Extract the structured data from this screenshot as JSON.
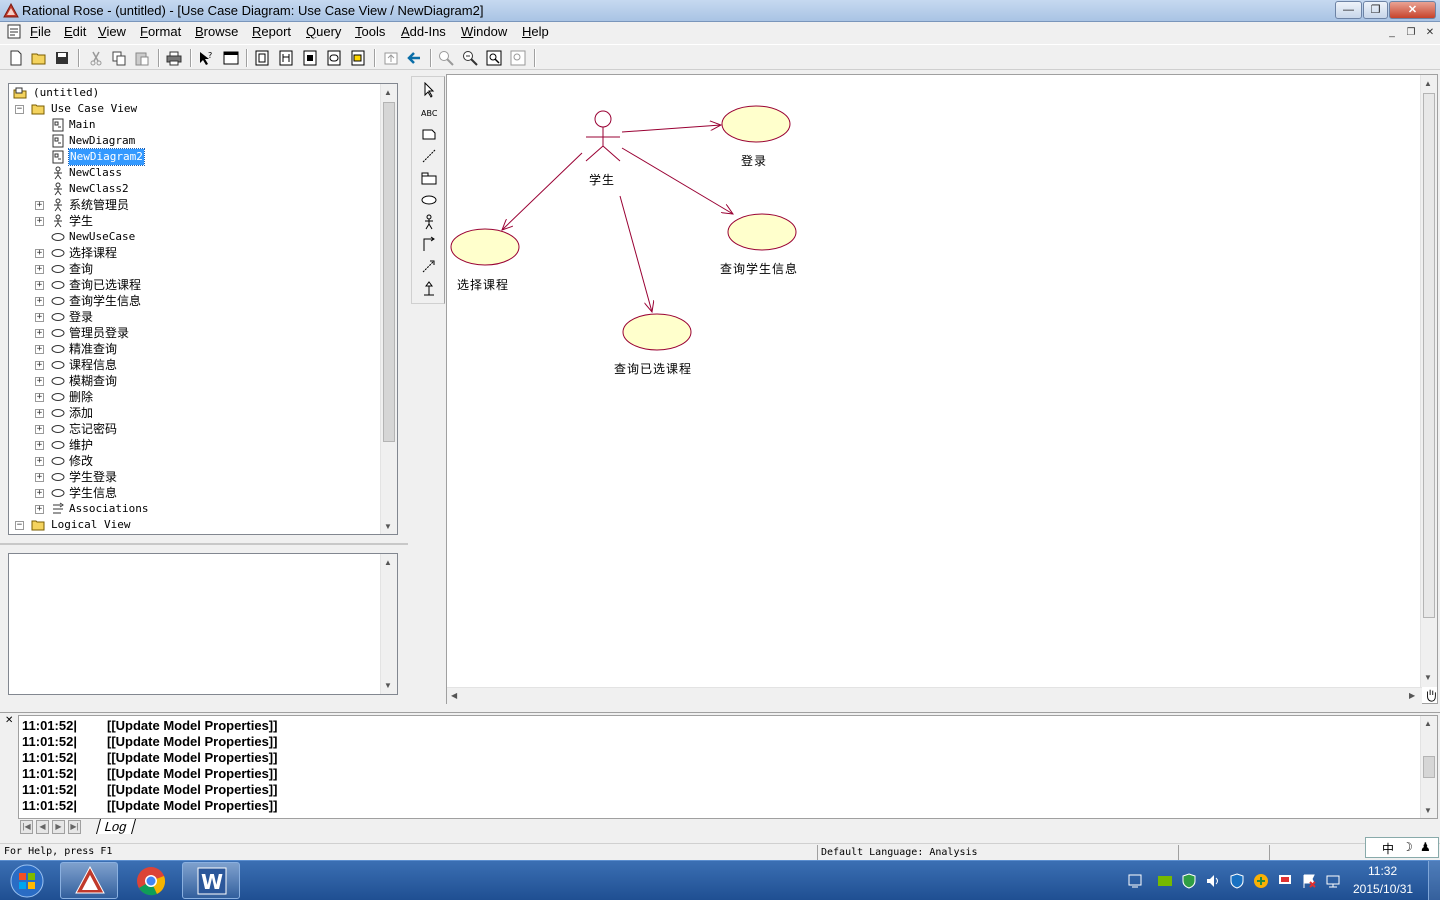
{
  "window": {
    "title": "Rational Rose - (untitled) - [Use Case Diagram: Use Case View / NewDiagram2]"
  },
  "menu": [
    "File",
    "Edit",
    "View",
    "Format",
    "Browse",
    "Report",
    "Query",
    "Tools",
    "Add-Ins",
    "Window",
    "Help"
  ],
  "mdi_buttons": [
    "_",
    "❐",
    "✕"
  ],
  "browser": {
    "root": "(untitled)",
    "use_case_view": "Use Case View",
    "items": [
      {
        "label": "Main",
        "icon": "diagram-icon",
        "expandable": false
      },
      {
        "label": "NewDiagram",
        "icon": "diagram-icon",
        "expandable": false
      },
      {
        "label": "NewDiagram2",
        "icon": "diagram-icon",
        "expandable": false,
        "selected": true
      },
      {
        "label": "NewClass",
        "icon": "actor-icon",
        "expandable": false
      },
      {
        "label": "NewClass2",
        "icon": "actor-icon",
        "expandable": false
      },
      {
        "label": "系统管理员",
        "icon": "actor-icon",
        "expandable": true
      },
      {
        "label": "学生",
        "icon": "actor-icon",
        "expandable": true
      },
      {
        "label": "NewUseCase",
        "icon": "usecase-icon",
        "expandable": false
      },
      {
        "label": "选择课程",
        "icon": "usecase-icon",
        "expandable": true
      },
      {
        "label": "查询",
        "icon": "usecase-icon",
        "expandable": true
      },
      {
        "label": "查询已选课程",
        "icon": "usecase-icon",
        "expandable": true
      },
      {
        "label": "查询学生信息",
        "icon": "usecase-icon",
        "expandable": true
      },
      {
        "label": "登录",
        "icon": "usecase-icon",
        "expandable": true
      },
      {
        "label": "管理员登录",
        "icon": "usecase-icon",
        "expandable": true
      },
      {
        "label": "精准查询",
        "icon": "usecase-icon",
        "expandable": true
      },
      {
        "label": "课程信息",
        "icon": "usecase-icon",
        "expandable": true
      },
      {
        "label": "模糊查询",
        "icon": "usecase-icon",
        "expandable": true
      },
      {
        "label": "删除",
        "icon": "usecase-icon",
        "expandable": true
      },
      {
        "label": "添加",
        "icon": "usecase-icon",
        "expandable": true
      },
      {
        "label": "忘记密码",
        "icon": "usecase-icon",
        "expandable": true
      },
      {
        "label": "维护",
        "icon": "usecase-icon",
        "expandable": true
      },
      {
        "label": "修改",
        "icon": "usecase-icon",
        "expandable": true
      },
      {
        "label": "学生登录",
        "icon": "usecase-icon",
        "expandable": true
      },
      {
        "label": "学生信息",
        "icon": "usecase-icon",
        "expandable": true
      },
      {
        "label": "Associations",
        "icon": "associations-icon",
        "expandable": true
      }
    ],
    "logical_view": "Logical View"
  },
  "diagram": {
    "actor_label": "学生",
    "usecases": [
      "登录",
      "选择课程",
      "查询学生信息",
      "查询已选课程"
    ],
    "colors": {
      "usecase_fill": "#ffffcc",
      "association_line": "#990033"
    }
  },
  "log": {
    "tab_label": "Log",
    "entries": [
      {
        "time": "11:01:52|",
        "message": "[[Update Model Properties]]"
      },
      {
        "time": "11:01:52|",
        "message": "[[Update Model Properties]]"
      },
      {
        "time": "11:01:52|",
        "message": "[[Update Model Properties]]"
      },
      {
        "time": "11:01:52|",
        "message": "[[Update Model Properties]]"
      },
      {
        "time": "11:01:52|",
        "message": "[[Update Model Properties]]"
      },
      {
        "time": "11:01:52|",
        "message": "[[Update Model Properties]]"
      }
    ]
  },
  "status": {
    "help": "For Help, press F1",
    "language": "Default Language: Analysis"
  },
  "ime": {
    "mode": "中"
  },
  "taskbar": {
    "time": "11:32",
    "date": "2015/10/31"
  }
}
